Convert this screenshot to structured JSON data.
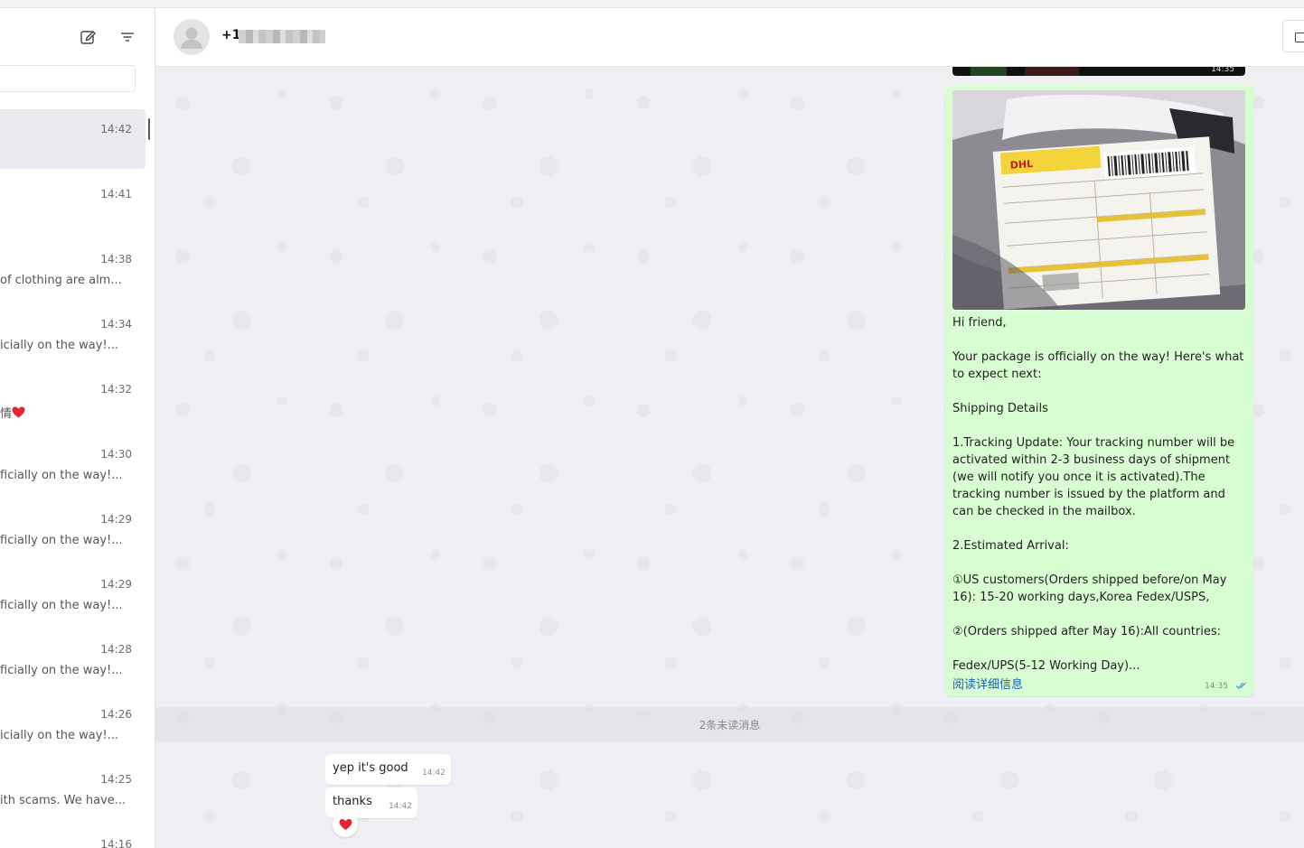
{
  "sidebar": {
    "compose_icon": "compose-icon",
    "filter_icon": "filter-icon",
    "search_placeholder": "",
    "chats": [
      {
        "time": "14:42",
        "preview": "",
        "active": true
      },
      {
        "time": "14:41",
        "preview": ""
      },
      {
        "time": "14:38",
        "preview": "of clothing are alm..."
      },
      {
        "time": "14:34",
        "preview": "icially on the way!..."
      },
      {
        "time": "14:32",
        "preview": "情"
      },
      {
        "time": "14:30",
        "preview": "ficially on the way!..."
      },
      {
        "time": "14:29",
        "preview": "ficially on the way!..."
      },
      {
        "time": "14:29",
        "preview": "ficially on the way!..."
      },
      {
        "time": "14:28",
        "preview": "ficially on the way!..."
      },
      {
        "time": "14:26",
        "preview": "icially on the way!..."
      },
      {
        "time": "14:25",
        "preview": "ith scams. We have..."
      },
      {
        "time": "14:16",
        "preview": ""
      }
    ]
  },
  "header": {
    "contact_prefix": "+1",
    "avatar_icon": "default-avatar-icon"
  },
  "conversation": {
    "image_strip_time": "14:35",
    "outgoing": {
      "lines": [
        "Hi friend,",
        "",
        "Your package is officially on the way!  Here's what to expect next:",
        "",
        "Shipping Details",
        "",
        "1.Tracking Update: Your tracking number will be activated within 2-3 business days of shipment (we will notify you once it is activated).The tracking number is issued by the platform and can be checked in the mailbox.",
        "",
        "2.Estimated Arrival:",
        "",
        "①US customers(Orders shipped before/on May 16): 15-20 working days,Korea Fedex/USPS,",
        "",
        "②(Orders shipped after May 16):All countries:",
        "",
        "Fedex/UPS(5-12 Working Day)..."
      ],
      "read_more": "阅读详细信息",
      "time": "14:35",
      "status_icon": "double-check-icon",
      "image_label": "DHL"
    },
    "unread_divider": "2条未读消息",
    "incoming": [
      {
        "text": "yep it's good",
        "time": "14:42"
      },
      {
        "text": "thanks",
        "time": "14:42",
        "reaction": "heart-icon"
      }
    ]
  },
  "colors": {
    "outgoing_bubble": "#d9fdd3",
    "incoming_bubble": "#ffffff",
    "link": "#1a5fb4",
    "read_ticks": "#4a90e2",
    "heart": "#e0262f"
  }
}
